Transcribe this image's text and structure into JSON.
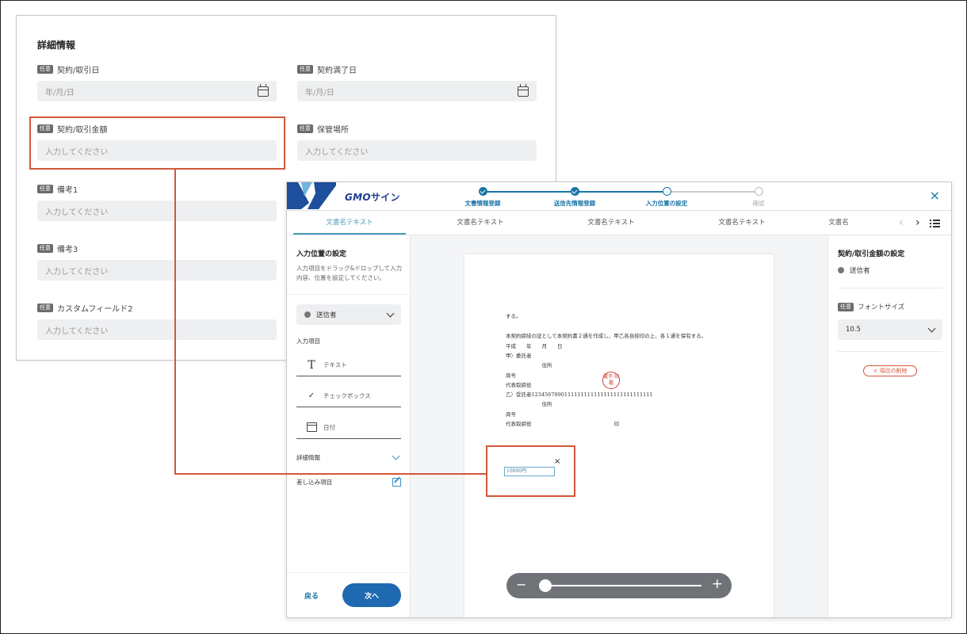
{
  "detail": {
    "title": "詳細情報",
    "badge": "任意",
    "fields": [
      {
        "label": "契約/取引日",
        "placeholder": "年/月/日",
        "calendar": true
      },
      {
        "label": "契約満了日",
        "placeholder": "年/月/日",
        "calendar": true
      },
      {
        "label": "契約/取引金額",
        "placeholder": "入力してください",
        "calendar": false
      },
      {
        "label": "保管場所",
        "placeholder": "入力してください",
        "calendar": false
      },
      {
        "label": "備考1",
        "placeholder": "入力してください",
        "calendar": false
      },
      {
        "label": "備考3",
        "placeholder": "入力してください",
        "calendar": false
      },
      {
        "label": "カスタムフィールド2",
        "placeholder": "入力してください",
        "calendar": false
      }
    ]
  },
  "editor": {
    "logo": {
      "gmo": "GMO",
      "name": "サイン"
    },
    "steps": [
      {
        "label": "文書情報登録",
        "state": "done"
      },
      {
        "label": "送信先情報登録",
        "state": "done"
      },
      {
        "label": "入力位置の設定",
        "state": "current"
      },
      {
        "label": "確認",
        "state": "todo"
      }
    ],
    "close": "×",
    "tabs": [
      "文書名テキスト",
      "文書名テキスト",
      "文書名テキスト",
      "文書名テキスト",
      "文書名"
    ],
    "tab_prev": "‹",
    "tab_next": "›",
    "sidebar": {
      "title": "入力位置の設定",
      "description": "入力項目をドラッグ&ドロップして入力内容、位置を設定してください。",
      "sender": "送信者",
      "items_title": "入力項目",
      "items": [
        {
          "label": "テキスト",
          "icon": "T"
        },
        {
          "label": "チェックボックス",
          "icon": "✓"
        },
        {
          "label": "日付",
          "icon": ""
        }
      ],
      "details_label": "詳細情報",
      "merge_label": "差し込み項目",
      "back": "戻る",
      "next": "次へ"
    },
    "document": {
      "lines": [
        "する。",
        "本契約締結の証として本契約書２通を作成し、甲乙各自捺印の上、各１通を保有する。",
        "平成　　年　　月　　日",
        "甲）委託者",
        "　　　　　　　住所",
        "商号",
        "代表取締役",
        "乙）受託者1234567890111111111111111111111111111",
        "　　　　　　　住所",
        "商号",
        "代表取締役　　　　　　　　　　　　　　　　印"
      ],
      "seal_text": "電子\n印鑑",
      "amount_value": "10000円",
      "amount_remove": "×",
      "zoom_minus": "−",
      "zoom_plus": "+",
      "zoom_level": 0.02
    },
    "right_panel": {
      "title": "契約/取引金額の設定",
      "sender": "送信者",
      "badge": "任意",
      "font_size_label": "フォントサイズ",
      "font_size_value": "10.5",
      "delete_label": "× 項目の削除"
    }
  },
  "colors": {
    "accent": "#1a75a8",
    "highlight": "#d2573b",
    "primary_button": "#1f69b0",
    "seal": "#d23b2e"
  }
}
